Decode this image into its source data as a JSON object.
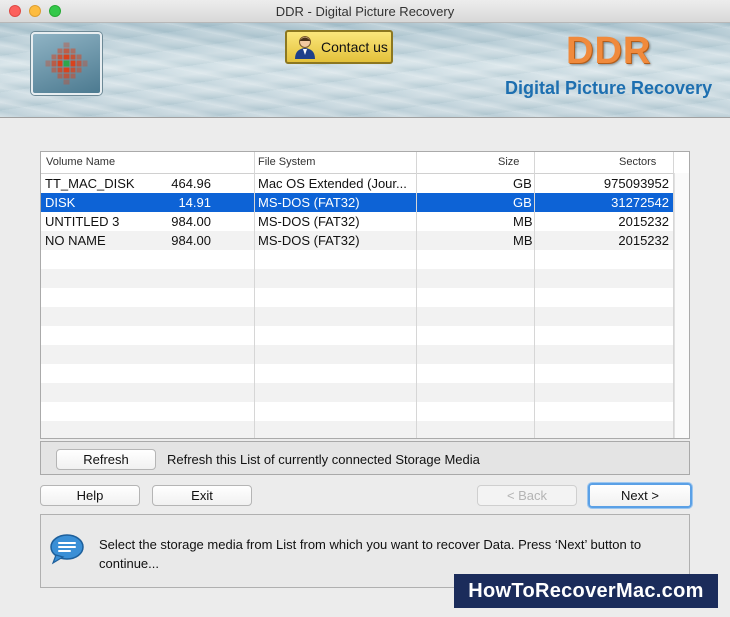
{
  "window": {
    "title": "DDR - Digital Picture Recovery"
  },
  "header": {
    "contact_label": "Contact us",
    "brand": "DDR",
    "subtitle": "Digital Picture Recovery"
  },
  "table": {
    "columns": [
      "Volume Name",
      "File System",
      "Size",
      "Sectors"
    ],
    "rows": [
      {
        "volume": "TT_MAC_DISK",
        "fs": "Mac OS Extended (Jour...",
        "size": "464.96",
        "unit": "GB",
        "sectors": "975093952"
      },
      {
        "volume": "DISK",
        "fs": "MS-DOS (FAT32)",
        "size": "14.91",
        "unit": "GB",
        "sectors": "31272542",
        "selected": true
      },
      {
        "volume": "UNTITLED 3",
        "fs": "MS-DOS (FAT32)",
        "size": "984.00",
        "unit": "MB",
        "sectors": "2015232"
      },
      {
        "volume": "NO NAME",
        "fs": "MS-DOS (FAT32)",
        "size": "984.00",
        "unit": "MB",
        "sectors": "2015232"
      }
    ],
    "selection_color": "#0d63d6"
  },
  "refresh": {
    "button_label": "Refresh",
    "description": "Refresh this List of currently connected Storage Media"
  },
  "nav": {
    "help_label": "Help",
    "exit_label": "Exit",
    "back_label": "< Back",
    "next_label": "Next >"
  },
  "message": {
    "icon": "speech-bubble-icon",
    "text": "Select the storage media from List from which you want to recover Data. Press ‘Next’ button to continue..."
  },
  "watermark": "HowToRecoverMac.com"
}
